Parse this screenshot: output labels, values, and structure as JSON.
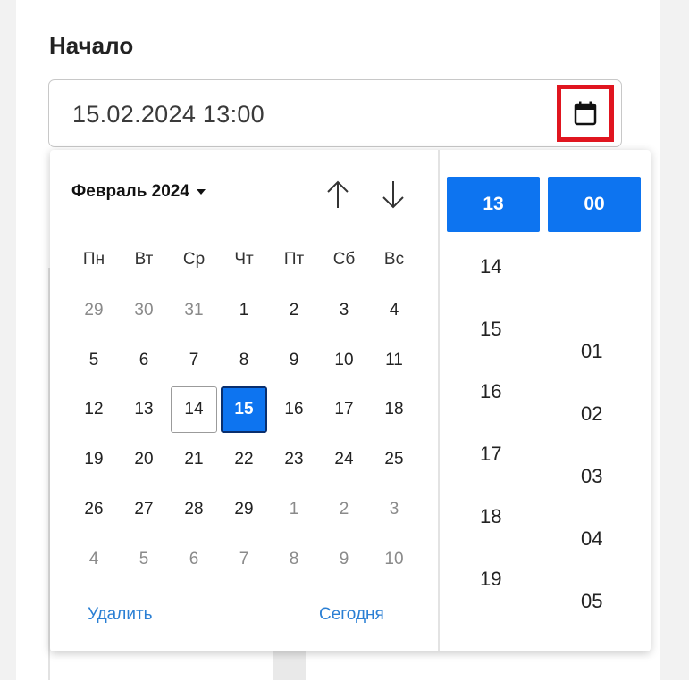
{
  "field": {
    "label": "Начало",
    "value": "15.02.2024 13:00",
    "calendar_icon": "calendar-icon"
  },
  "calendar": {
    "month_label": "Февраль 2024",
    "nav": {
      "up_icon": "arrow-up-icon",
      "down_icon": "arrow-down-icon"
    },
    "weekdays": [
      "Пн",
      "Вт",
      "Ср",
      "Чт",
      "Пт",
      "Сб",
      "Вс"
    ],
    "weeks": [
      [
        "29",
        "30",
        "31",
        "1",
        "2",
        "3",
        "4"
      ],
      [
        "5",
        "6",
        "7",
        "8",
        "9",
        "10",
        "11"
      ],
      [
        "12",
        "13",
        "14",
        "15",
        "16",
        "17",
        "18"
      ],
      [
        "19",
        "20",
        "21",
        "22",
        "23",
        "24",
        "25"
      ],
      [
        "26",
        "27",
        "28",
        "29",
        "1",
        "2",
        "3"
      ],
      [
        "4",
        "5",
        "6",
        "7",
        "8",
        "9",
        "10"
      ]
    ],
    "today": "14",
    "selected": "15",
    "clear_label": "Удалить",
    "today_label": "Сегодня"
  },
  "time": {
    "hours": [
      "13",
      "14",
      "15",
      "16",
      "17",
      "18",
      "19"
    ],
    "minutes": [
      "00",
      "01",
      "02",
      "03",
      "04",
      "05"
    ],
    "selected_hour": "13",
    "selected_minute": "00"
  },
  "colors": {
    "accent": "#0d74f0",
    "highlight_border": "#e0151f",
    "link": "#2a7fd4"
  }
}
